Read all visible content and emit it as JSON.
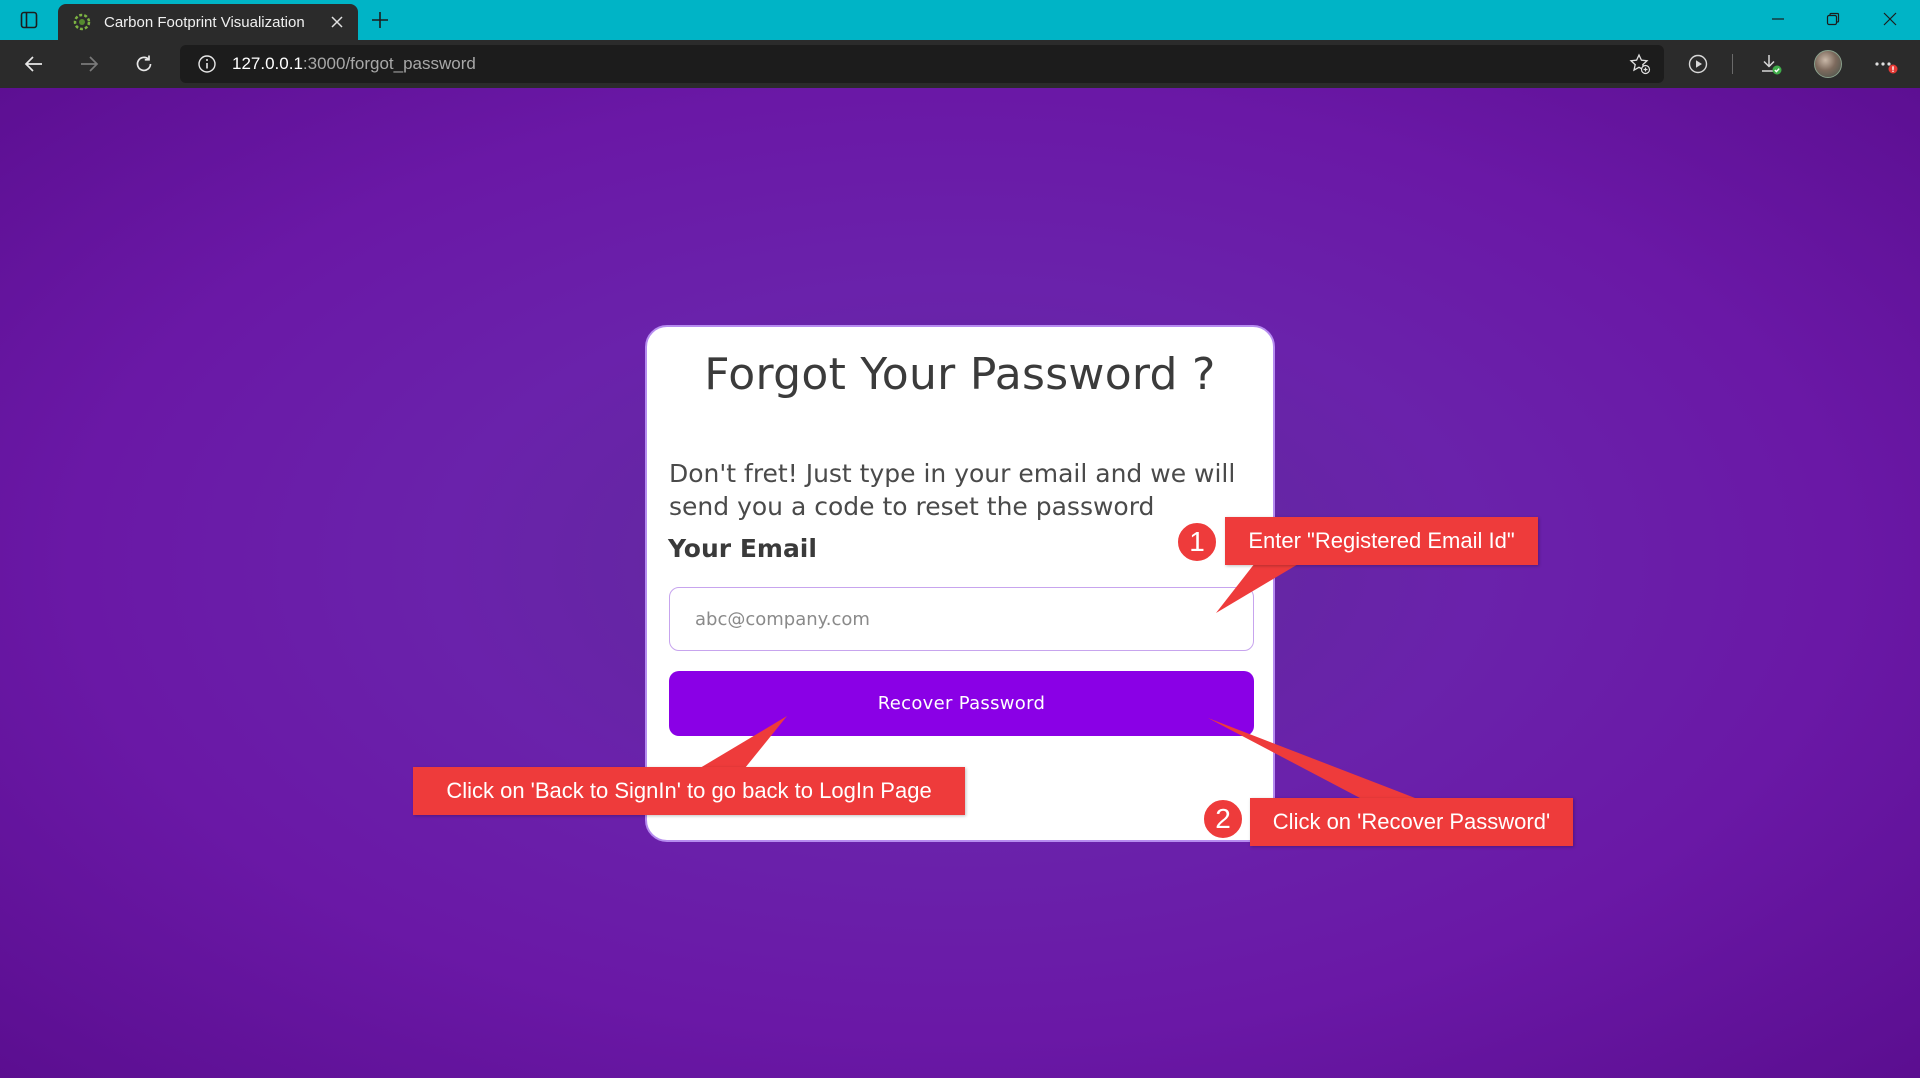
{
  "browser": {
    "tab_title": "Carbon Footprint Visualization",
    "url_host": "127.0.0.1",
    "url_path": ":3000/forgot_password"
  },
  "card": {
    "title": "Forgot Your Password ?",
    "description": "Don't fret! Just type in your email and we will send you a code to reset the password",
    "email_label": "Your Email",
    "email_placeholder": "abc@company.com",
    "email_value": "",
    "recover_button": "Recover Password"
  },
  "annotations": {
    "step1_number": "1",
    "step1_text": "Enter \"Registered Email Id\"",
    "step2_number": "2",
    "step2_text": "Click on 'Recover Password'",
    "back_text": "Click on 'Back to SignIn' to go back to LogIn Page"
  },
  "colors": {
    "titlebar": "#00b4c6",
    "background": "#6a22ab",
    "button": "#8a00e6",
    "annotation": "#ee3b3b"
  }
}
